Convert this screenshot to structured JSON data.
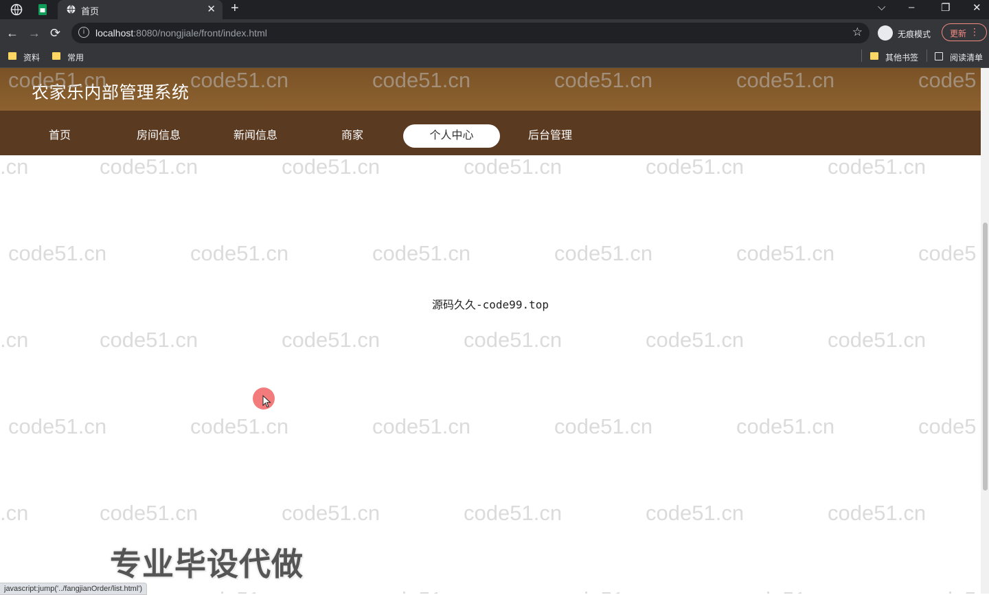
{
  "browser": {
    "tabs": [
      {
        "title": "首页",
        "active": true
      }
    ],
    "url_host": "localhost",
    "url_rest": ":8080/nongjiale/front/index.html",
    "incognito_label": "无痕模式",
    "update_label": "更新",
    "bookmarks_left": [
      "资料",
      "常用"
    ],
    "bookmarks_right": [
      "其他书签",
      "阅读清单"
    ],
    "status_text": "javascript:jump('../fangjianOrder/list.html')"
  },
  "site": {
    "title": "农家乐内部管理系统",
    "nav": [
      {
        "label": "首页",
        "active": false
      },
      {
        "label": "房间信息",
        "active": false
      },
      {
        "label": "新闻信息",
        "active": false
      },
      {
        "label": "商家",
        "active": false
      },
      {
        "label": "个人中心",
        "active": true
      },
      {
        "label": "后台管理",
        "active": false
      }
    ],
    "content_text": "源码久久-code99.top"
  },
  "overlay": {
    "watermark": "code51.cn",
    "watermark_partial_left": ".cn",
    "watermark_partial_right": "code5",
    "promo_text": "专业毕设代做"
  },
  "colors": {
    "header": "#8d6230",
    "nav": "#5b3a22",
    "accent_update": "#f28b82"
  }
}
